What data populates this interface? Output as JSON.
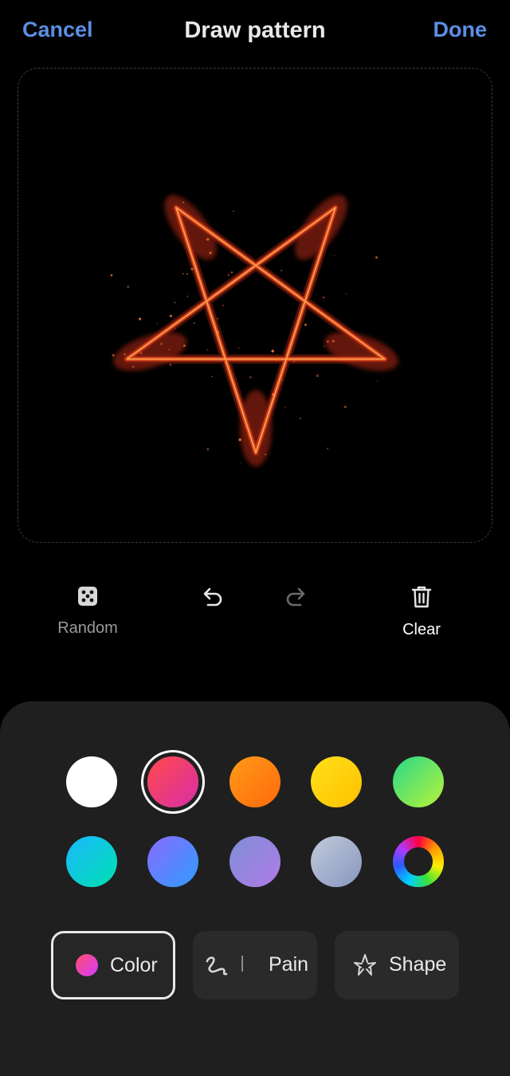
{
  "header": {
    "cancel_label": "Cancel",
    "title": "Draw pattern",
    "done_label": "Done"
  },
  "canvas": {
    "pattern": "pentagram",
    "stroke_color": "#ff5a2a"
  },
  "tools": {
    "random_label": "Random",
    "clear_label": "Clear",
    "undo_enabled": true,
    "redo_enabled": false
  },
  "palette": {
    "selected_index": 1,
    "swatches": [
      {
        "name": "white",
        "color": "#ffffff"
      },
      {
        "name": "pink-red",
        "color": "#ff3d6e"
      },
      {
        "name": "orange",
        "color": "#ff8a1a"
      },
      {
        "name": "yellow",
        "color": "#ffd91a"
      },
      {
        "name": "green",
        "color": "#5ee86a"
      },
      {
        "name": "cyan",
        "color": "#14d3d8"
      },
      {
        "name": "blue-violet",
        "color": "#6b7dff"
      },
      {
        "name": "lavender",
        "color": "#a487e6"
      },
      {
        "name": "grey-blue",
        "color": "#9fb0cc"
      },
      {
        "name": "custom-color-wheel",
        "color": "conic"
      }
    ]
  },
  "tabs": {
    "color_label": "Color",
    "paint_label": "Pain",
    "shape_label": "Shape",
    "active": "color"
  },
  "colors": {
    "accent": "#5b8fe6",
    "sheet_bg": "#1f1f1f"
  }
}
